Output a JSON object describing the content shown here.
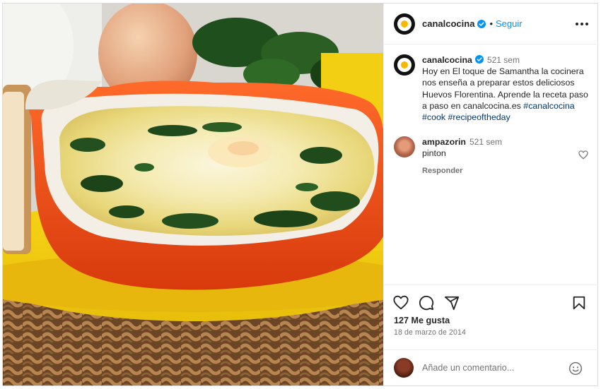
{
  "post": {
    "image_alt": "Huevos Florentina en cazuela naranja con espinacas y queso gratinado",
    "author": {
      "username": "canalcocina",
      "verified": true,
      "follow_label": "Seguir",
      "separator": "•"
    },
    "caption": {
      "username": "canalcocina",
      "time": "521 sem",
      "text": "Hoy en El toque de Samantha la cocinera nos enseña a preparar estos deliciosos Huevos Florentina. Aprende la receta paso a paso en canalcocina.es",
      "hashtags": [
        "#canalcocina",
        "#cook",
        "#recipeoftheday"
      ]
    },
    "comments": [
      {
        "username": "ampazorin",
        "time": "521 sem",
        "text": "pinton",
        "reply_label": "Responder"
      }
    ],
    "likes_label": "127 Me gusta",
    "date": "18 de marzo de 2014",
    "composer": {
      "placeholder": "Añade un comentario..."
    }
  },
  "icons": {
    "header": [
      "verified-badge-icon",
      "more-options-icon"
    ],
    "actions": [
      "heart-icon",
      "comment-icon",
      "share-icon",
      "bookmark-icon"
    ],
    "composer": [
      "emoji-icon"
    ]
  },
  "colors": {
    "link_blue": "#0095f6",
    "hashtag": "#00376b",
    "secondary_text": "#737373",
    "border": "#dbdbdb"
  }
}
